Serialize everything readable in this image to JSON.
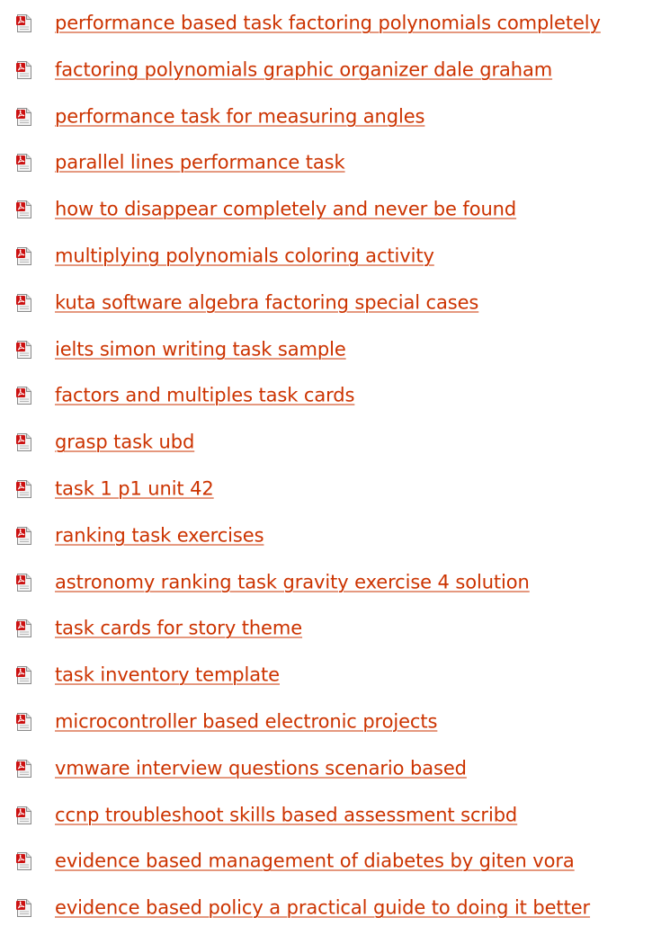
{
  "icon": "pdf-file-icon",
  "colors": {
    "link": "#cc3300",
    "icon_red": "#cc1111",
    "icon_page": "#f4f4f4",
    "icon_border": "#8a8a8a"
  },
  "items": [
    {
      "label": "performance based task factoring polynomials completely"
    },
    {
      "label": "factoring polynomials graphic organizer dale graham"
    },
    {
      "label": "performance task for measuring angles"
    },
    {
      "label": "parallel lines performance task"
    },
    {
      "label": "how to disappear completely and never be found"
    },
    {
      "label": "multiplying polynomials coloring activity"
    },
    {
      "label": "kuta software algebra factoring special cases"
    },
    {
      "label": "ielts simon writing task sample"
    },
    {
      "label": "factors and multiples task cards"
    },
    {
      "label": "grasp task ubd"
    },
    {
      "label": "task 1 p1 unit 42"
    },
    {
      "label": "ranking task exercises"
    },
    {
      "label": "astronomy ranking task gravity exercise 4 solution"
    },
    {
      "label": "task cards for story theme"
    },
    {
      "label": "task inventory template"
    },
    {
      "label": "microcontroller based electronic projects"
    },
    {
      "label": "vmware interview questions scenario based"
    },
    {
      "label": "ccnp troubleshoot skills based assessment scribd"
    },
    {
      "label": "evidence based management of diabetes by giten vora"
    },
    {
      "label": "evidence based policy a practical guide to doing it better"
    }
  ]
}
